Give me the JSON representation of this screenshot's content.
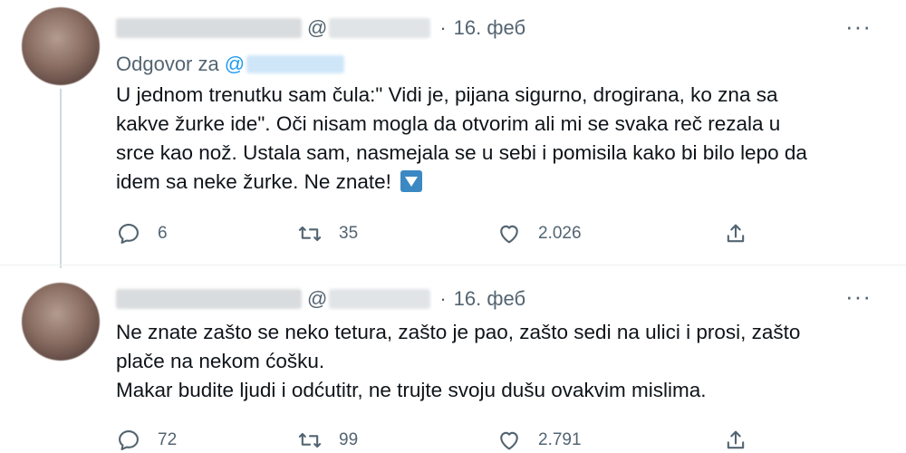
{
  "tweets": [
    {
      "date": "16. феб",
      "reply_label": "Odgovor za",
      "text": "U jednom trenutku sam čula:\" Vidi je, pijana sigurno, drogirana, ko zna sa\nkakve žurke ide\". Oči nisam mogla da otvorim ali mi se svaka reč rezala u\nsrce kao nož. Ustala sam, nasmejala se u sebi i pomisila kako bi bilo lepo da\nidem sa neke žurke. Ne znate!",
      "replies": "6",
      "retweets": "35",
      "likes": "2.026"
    },
    {
      "date": "16. феб",
      "text": "Ne znate zašto se neko tetura, zašto je pao, zašto sedi na ulici i prosi, zašto\nplače na nekom ćošku.\nMakar budite ljudi i odćutitr, ne trujte svoju dušu ovakvim mislima.",
      "replies": "72",
      "retweets": "99",
      "likes": "2.791"
    }
  ],
  "symbols": {
    "at": "@",
    "dot": "·",
    "more": "···",
    "reply_at": "@"
  },
  "icons": [
    "reply-icon",
    "retweet-icon",
    "like-icon",
    "share-icon",
    "arrow-down-emoji-icon"
  ],
  "colors": {
    "accent": "#1d9bf0",
    "muted": "#536471",
    "text": "#0f1419"
  }
}
